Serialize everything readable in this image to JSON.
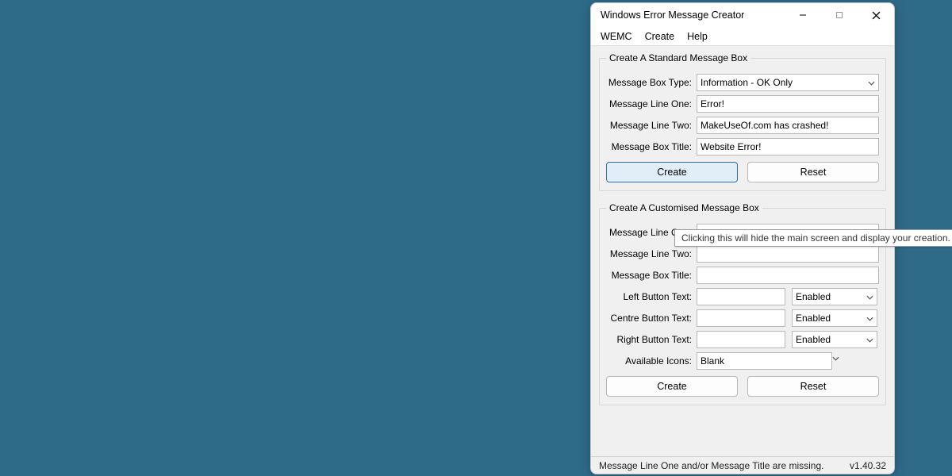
{
  "window": {
    "title": "Windows Error Message Creator"
  },
  "menu": {
    "wemc": "WEMC",
    "create": "Create",
    "help": "Help"
  },
  "tooltip": "Clicking this will hide the main screen and display your creation.",
  "standard": {
    "legend": "Create A Standard Message Box",
    "type_label": "Message Box Type:",
    "type_value": "Information - OK Only",
    "line1_label": "Message Line One:",
    "line1_value": "Error!",
    "line2_label": "Message Line Two:",
    "line2_value": "MakeUseOf.com has crashed!",
    "title_label": "Message Box Title:",
    "title_value": "Website Error!",
    "create_btn": "Create",
    "reset_btn": "Reset"
  },
  "custom": {
    "legend": "Create A Customised Message Box",
    "line1_label": "Message Line One:",
    "line1_value": "",
    "line2_label": "Message Line Two:",
    "line2_value": "",
    "title_label": "Message Box Title:",
    "title_value": "",
    "left_label": "Left Button Text:",
    "left_value": "",
    "left_state": "Enabled",
    "centre_label": "Centre Button Text:",
    "centre_value": "",
    "centre_state": "Enabled",
    "right_label": "Right Button Text:",
    "right_value": "",
    "right_state": "Enabled",
    "icons_label": "Available Icons:",
    "icons_value": "Blank",
    "create_btn": "Create",
    "reset_btn": "Reset"
  },
  "status": {
    "message": "Message Line One and/or Message Title are missing.",
    "version": "v1.40.32"
  }
}
